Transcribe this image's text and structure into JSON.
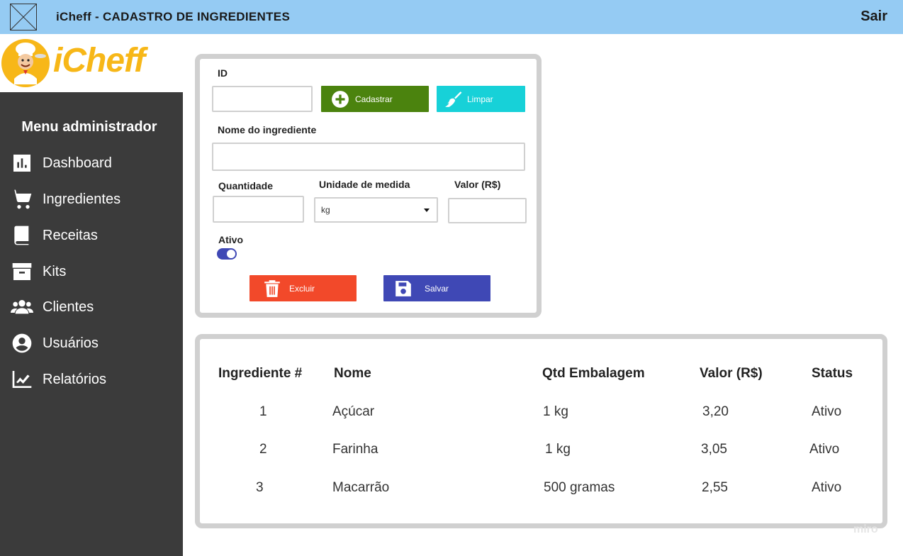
{
  "topbar": {
    "title": "iCheff - CADASTRO DE INGREDIENTES",
    "logout": "Sair"
  },
  "sidebar": {
    "brand": "iCheff",
    "menu_title": "Menu administrador",
    "items": [
      {
        "label": "Dashboard",
        "icon": "bar-chart-icon"
      },
      {
        "label": "Ingredientes",
        "icon": "cart-icon"
      },
      {
        "label": "Receitas",
        "icon": "book-icon"
      },
      {
        "label": "Kits",
        "icon": "archive-box-icon"
      },
      {
        "label": "Clientes",
        "icon": "users-icon"
      },
      {
        "label": "Usuários",
        "icon": "user-circle-icon"
      },
      {
        "label": "Relatórios",
        "icon": "line-chart-icon"
      }
    ]
  },
  "form": {
    "id_label": "ID",
    "id_value": "",
    "cadastrar_label": "Cadastrar",
    "limpar_label": "Limpar",
    "nome_label": "Nome do ingrediente",
    "nome_value": "",
    "quantidade_label": "Quantidade",
    "quantidade_value": "",
    "unidade_label": "Unidade de medida",
    "unidade_value": "kg",
    "valor_label": "Valor (R$)",
    "valor_value": "",
    "ativo_label": "Ativo",
    "ativo": true,
    "excluir_label": "Excluir",
    "salvar_label": "Salvar",
    "colors": {
      "cadastrar": "#4b830e",
      "limpar": "#17d1d8",
      "excluir": "#f2492a",
      "salvar": "#3f48b5"
    }
  },
  "table": {
    "headers": [
      "Ingrediente #",
      "Nome",
      "Qtd Embalagem",
      "Valor (R$)",
      "Status"
    ],
    "rows": [
      [
        "1",
        "Açúcar",
        "1 kg",
        "3,20",
        "Ativo"
      ],
      [
        "2",
        "Farinha",
        "1 kg",
        "3,05",
        "Ativo"
      ],
      [
        "3",
        "Macarrão",
        "500 gramas",
        "2,55",
        "Ativo"
      ]
    ]
  },
  "watermark": "miro"
}
